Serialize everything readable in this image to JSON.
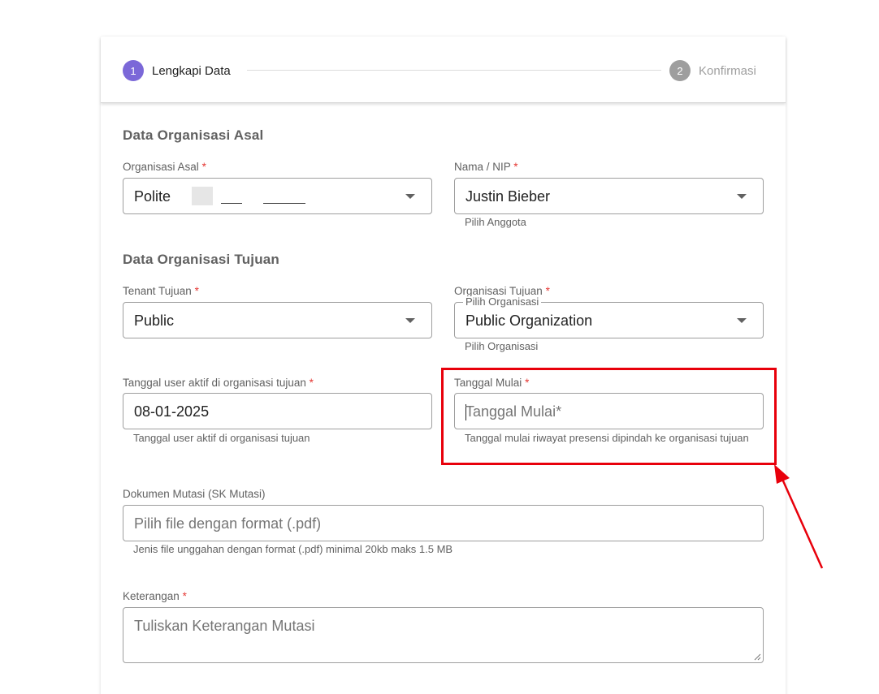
{
  "stepper": {
    "step1": {
      "number": "1",
      "label": "Lengkapi Data"
    },
    "step2": {
      "number": "2",
      "label": "Konfirmasi"
    }
  },
  "sections": {
    "asal": "Data Organisasi Asal",
    "tujuan": "Data Organisasi Tujuan"
  },
  "fields": {
    "organisasi_asal": {
      "label": "Organisasi Asal",
      "value": "Polite"
    },
    "nama_nip": {
      "label": "Nama / NIP",
      "value": "Justin Bieber",
      "hint": "Pilih Anggota"
    },
    "tenant_tujuan": {
      "label": "Tenant Tujuan",
      "value": "Public"
    },
    "organisasi_tujuan": {
      "label": "Organisasi Tujuan",
      "legend": "Pilih Organisasi",
      "value": "Public Organization",
      "hint": "Pilih Organisasi"
    },
    "tanggal_aktif": {
      "label": "Tanggal user aktif di organisasi tujuan",
      "value": "08-01-2025",
      "hint": "Tanggal user aktif di organisasi tujuan"
    },
    "tanggal_mulai": {
      "label": "Tanggal Mulai",
      "placeholder": "Tanggal Mulai*",
      "hint": "Tanggal mulai riwayat presensi dipindah ke organisasi tujuan"
    },
    "dokumen": {
      "label": "Dokumen Mutasi (SK Mutasi)",
      "placeholder": "Pilih file dengan format (.pdf)",
      "hint": "Jenis file unggahan dengan format (.pdf) minimal 20kb maks 1.5 MB"
    },
    "keterangan": {
      "label": "Keterangan",
      "placeholder": "Tuliskan Keterangan Mutasi"
    }
  },
  "required_mark": "*",
  "colors": {
    "step_active": "#7b68d8",
    "step_inactive": "#9e9e9e",
    "required": "#e53935",
    "highlight": "#e8000b"
  }
}
